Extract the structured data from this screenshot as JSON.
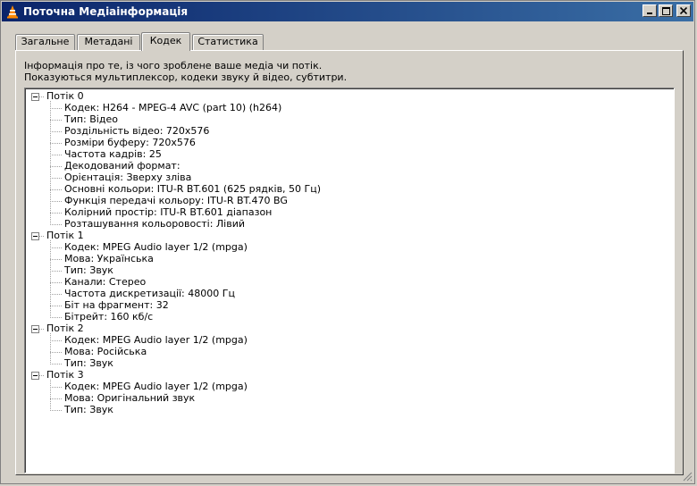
{
  "window": {
    "title": "Поточна Медіаінформація",
    "icon": "vlc-cone-icon"
  },
  "tabs": [
    {
      "label": "Загальне",
      "active": false
    },
    {
      "label": "Метадані",
      "active": false
    },
    {
      "label": "Кодек",
      "active": true
    },
    {
      "label": "Статистика",
      "active": false
    }
  ],
  "description": {
    "line1": "Інформація про те, із чого зроблене ваше медіа чи потік.",
    "line2": "Показуються мультиплексор, кодеки звуку й відео, субтитри."
  },
  "streams": [
    {
      "name": "Потік 0",
      "items": [
        "Кодек: H264 - MPEG-4 AVC (part 10) (h264)",
        "Тип: Відео",
        "Роздільність відео: 720x576",
        "Розміри буферу: 720x576",
        "Частота кадрів: 25",
        "Декодований формат:",
        "Орієнтація: Зверху зліва",
        "Основні кольори: ITU-R BT.601 (625 рядків, 50 Гц)",
        "Функція передачі кольору: ITU-R BT.470 BG",
        "Колірний простір: ITU-R BT.601 діапазон",
        "Розташування кольоровості: Лівий"
      ]
    },
    {
      "name": "Потік 1",
      "items": [
        "Кодек: MPEG Audio layer 1/2 (mpga)",
        "Мова: Українська",
        "Тип: Звук",
        "Канали: Стерео",
        "Частота дискретизації: 48000 Гц",
        "Біт на фрагмент: 32",
        "Бітрейт: 160 кб/с"
      ]
    },
    {
      "name": "Потік 2",
      "items": [
        "Кодек: MPEG Audio layer 1/2 (mpga)",
        "Мова: Російська",
        "Тип: Звук"
      ]
    },
    {
      "name": "Потік 3",
      "items": [
        "Кодек: MPEG Audio layer 1/2 (mpga)",
        "Мова: Оригінальний звук",
        "Тип: Звук"
      ]
    }
  ],
  "colors": {
    "titlebar_start": "#0a246a",
    "titlebar_end": "#3a6ea5",
    "face": "#d4d0c8"
  }
}
